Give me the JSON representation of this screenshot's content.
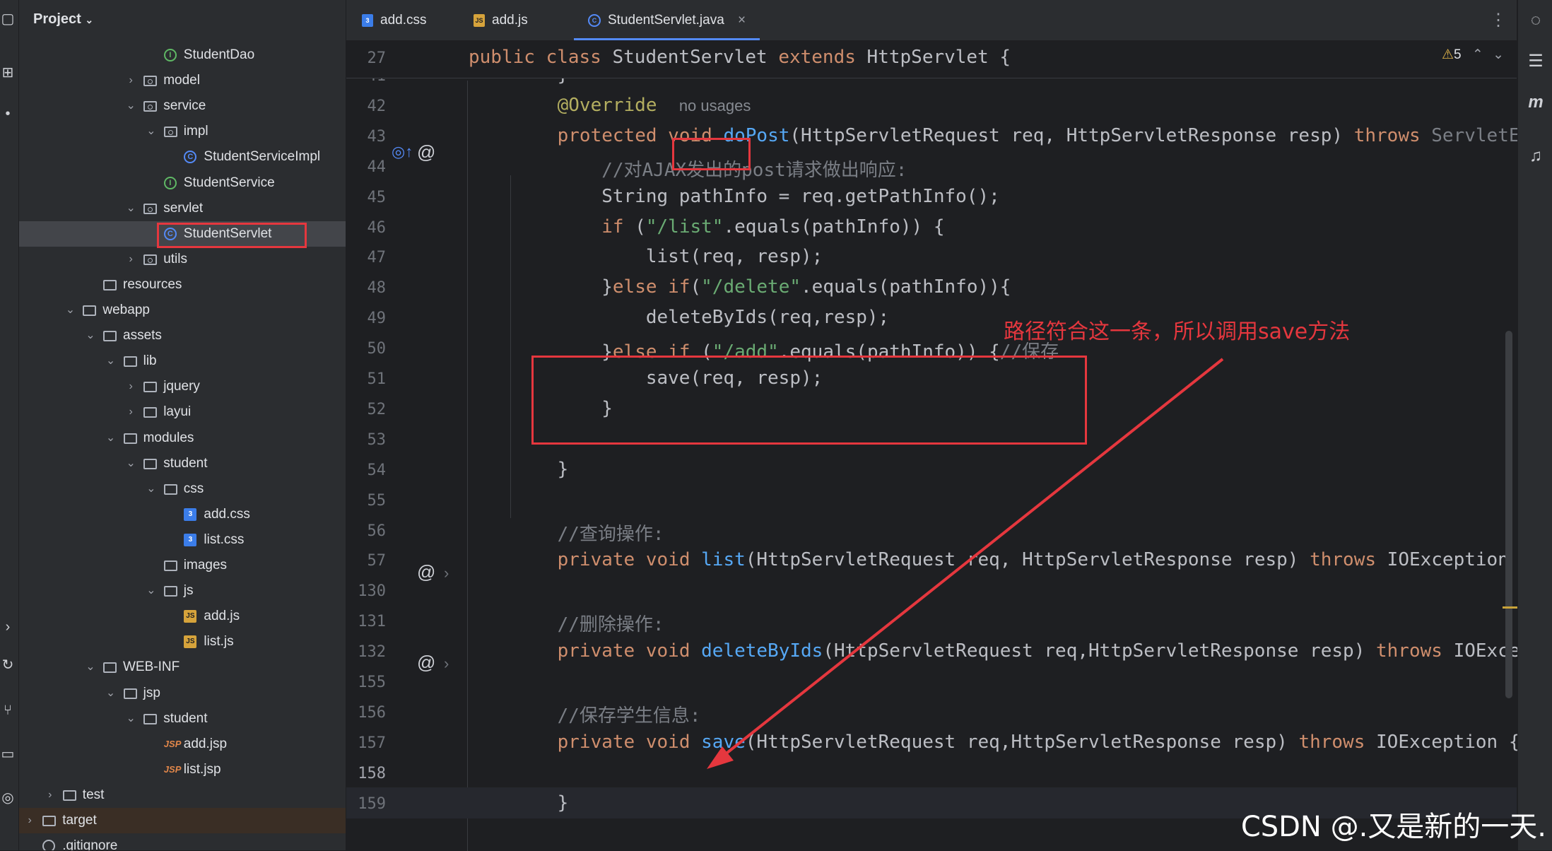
{
  "project_panel": {
    "title": "Project",
    "tree": [
      {
        "label": "StudentDao",
        "icon": "interface-icon",
        "depth": 8
      },
      {
        "label": "model",
        "icon": "package-icon",
        "depth": 7,
        "chevron": "collapsed"
      },
      {
        "label": "service",
        "icon": "package-icon",
        "depth": 7,
        "chevron": "expanded"
      },
      {
        "label": "impl",
        "icon": "package-icon",
        "depth": 8,
        "chevron": "expanded"
      },
      {
        "label": "StudentServiceImpl",
        "icon": "class-icon",
        "depth": 9
      },
      {
        "label": "StudentService",
        "icon": "interface-icon",
        "depth": 8
      },
      {
        "label": "servlet",
        "icon": "package-icon",
        "depth": 7,
        "chevron": "expanded"
      },
      {
        "label": "StudentServlet",
        "icon": "class-icon",
        "depth": 8,
        "selected": true
      },
      {
        "label": "utils",
        "icon": "package-icon",
        "depth": 7,
        "chevron": "collapsed"
      },
      {
        "label": "resources",
        "icon": "folder-icon",
        "depth": 5
      },
      {
        "label": "webapp",
        "icon": "folder-icon",
        "depth": 4,
        "chevron": "expanded"
      },
      {
        "label": "assets",
        "icon": "folder-icon",
        "depth": 5,
        "chevron": "expanded"
      },
      {
        "label": "lib",
        "icon": "folder-icon",
        "depth": 6,
        "chevron": "expanded"
      },
      {
        "label": "jquery",
        "icon": "folder-icon",
        "depth": 7,
        "chevron": "collapsed"
      },
      {
        "label": "layui",
        "icon": "folder-icon",
        "depth": 7,
        "chevron": "collapsed"
      },
      {
        "label": "modules",
        "icon": "folder-icon",
        "depth": 6,
        "chevron": "expanded"
      },
      {
        "label": "student",
        "icon": "folder-icon",
        "depth": 7,
        "chevron": "expanded"
      },
      {
        "label": "css",
        "icon": "folder-icon",
        "depth": 8,
        "chevron": "expanded"
      },
      {
        "label": "add.css",
        "icon": "css-file-icon",
        "depth": 9
      },
      {
        "label": "list.css",
        "icon": "css-file-icon",
        "depth": 9
      },
      {
        "label": "images",
        "icon": "folder-icon",
        "depth": 8
      },
      {
        "label": "js",
        "icon": "folder-icon",
        "depth": 8,
        "chevron": "expanded"
      },
      {
        "label": "add.js",
        "icon": "js-file-icon",
        "depth": 9
      },
      {
        "label": "list.js",
        "icon": "js-file-icon",
        "depth": 9
      },
      {
        "label": "WEB-INF",
        "icon": "folder-icon",
        "depth": 5,
        "chevron": "expanded"
      },
      {
        "label": "jsp",
        "icon": "folder-icon",
        "depth": 6,
        "chevron": "expanded"
      },
      {
        "label": "student",
        "icon": "folder-icon",
        "depth": 7,
        "chevron": "expanded"
      },
      {
        "label": "add.jsp",
        "icon": "jsp-file-icon",
        "depth": 8
      },
      {
        "label": "list.jsp",
        "icon": "jsp-file-icon",
        "depth": 8
      },
      {
        "label": "test",
        "icon": "folder-icon",
        "depth": 3,
        "chevron": "collapsed"
      },
      {
        "label": "target",
        "icon": "folder-icon",
        "depth": 2,
        "chevron": "collapsed",
        "excluded": true
      },
      {
        "label": ".gitignore",
        "icon": "gitignore-icon",
        "depth": 2
      }
    ]
  },
  "tabs": [
    {
      "label": "add.css",
      "icon": "css-file-icon"
    },
    {
      "label": "add.js",
      "icon": "js-file-icon"
    },
    {
      "label": "StudentServlet.java",
      "icon": "class-icon",
      "active": true,
      "close": "×"
    }
  ],
  "editor": {
    "warnings_count": "5",
    "sticky_line": {
      "num": "27",
      "code": "public class StudentServlet extends HttpServlet {"
    },
    "lines": [
      {
        "num": "41",
        "code": "    }"
      },
      {
        "num": "42",
        "annotation": "    @Override",
        "hint": "no usages"
      },
      {
        "num": "43",
        "code": "    protected void doPost(HttpServletRequest req, HttpServletResponse resp) throws ServletExc"
      },
      {
        "num": "44",
        "comment": "        //对AJAX发出的post请求做出响应:"
      },
      {
        "num": "45",
        "code": "        String pathInfo = req.getPathInfo();"
      },
      {
        "num": "46",
        "code": "        if (\"/list\".equals(pathInfo)) {"
      },
      {
        "num": "47",
        "code": "            list(req, resp);"
      },
      {
        "num": "48",
        "code": "        }else if(\"/delete\".equals(pathInfo)){"
      },
      {
        "num": "49",
        "code": "            deleteByIds(req,resp);"
      },
      {
        "num": "50",
        "code": "        }else if (\"/add\".equals(pathInfo)) {//保存"
      },
      {
        "num": "51",
        "code": "            save(req, resp);"
      },
      {
        "num": "52",
        "code": "        }"
      },
      {
        "num": "53",
        "code": ""
      },
      {
        "num": "54",
        "code": "    }"
      },
      {
        "num": "55",
        "code": ""
      },
      {
        "num": "56",
        "comment": "    //查询操作:"
      },
      {
        "num": "57",
        "code": "    private void list(HttpServletRequest req, HttpServletResponse resp) throws IOException {...}"
      },
      {
        "num": "130",
        "code": ""
      },
      {
        "num": "131",
        "comment": "    //删除操作:"
      },
      {
        "num": "132",
        "code": "    private void deleteByIds(HttpServletRequest req,HttpServletResponse resp) throws IOExcept"
      },
      {
        "num": "155",
        "code": ""
      },
      {
        "num": "156",
        "comment": "    //保存学生信息:"
      },
      {
        "num": "157",
        "code": "    private void save(HttpServletRequest req,HttpServletResponse resp) throws IOException {"
      },
      {
        "num": "158",
        "code": ""
      },
      {
        "num": "159",
        "code": "    }"
      }
    ]
  },
  "annotation_text": "路径符合这一条，所以调用save方法",
  "watermark": "CSDN @.又是新的一天.",
  "colors": {
    "annotation_red": "#e5373e",
    "accent_blue": "#548af7"
  }
}
